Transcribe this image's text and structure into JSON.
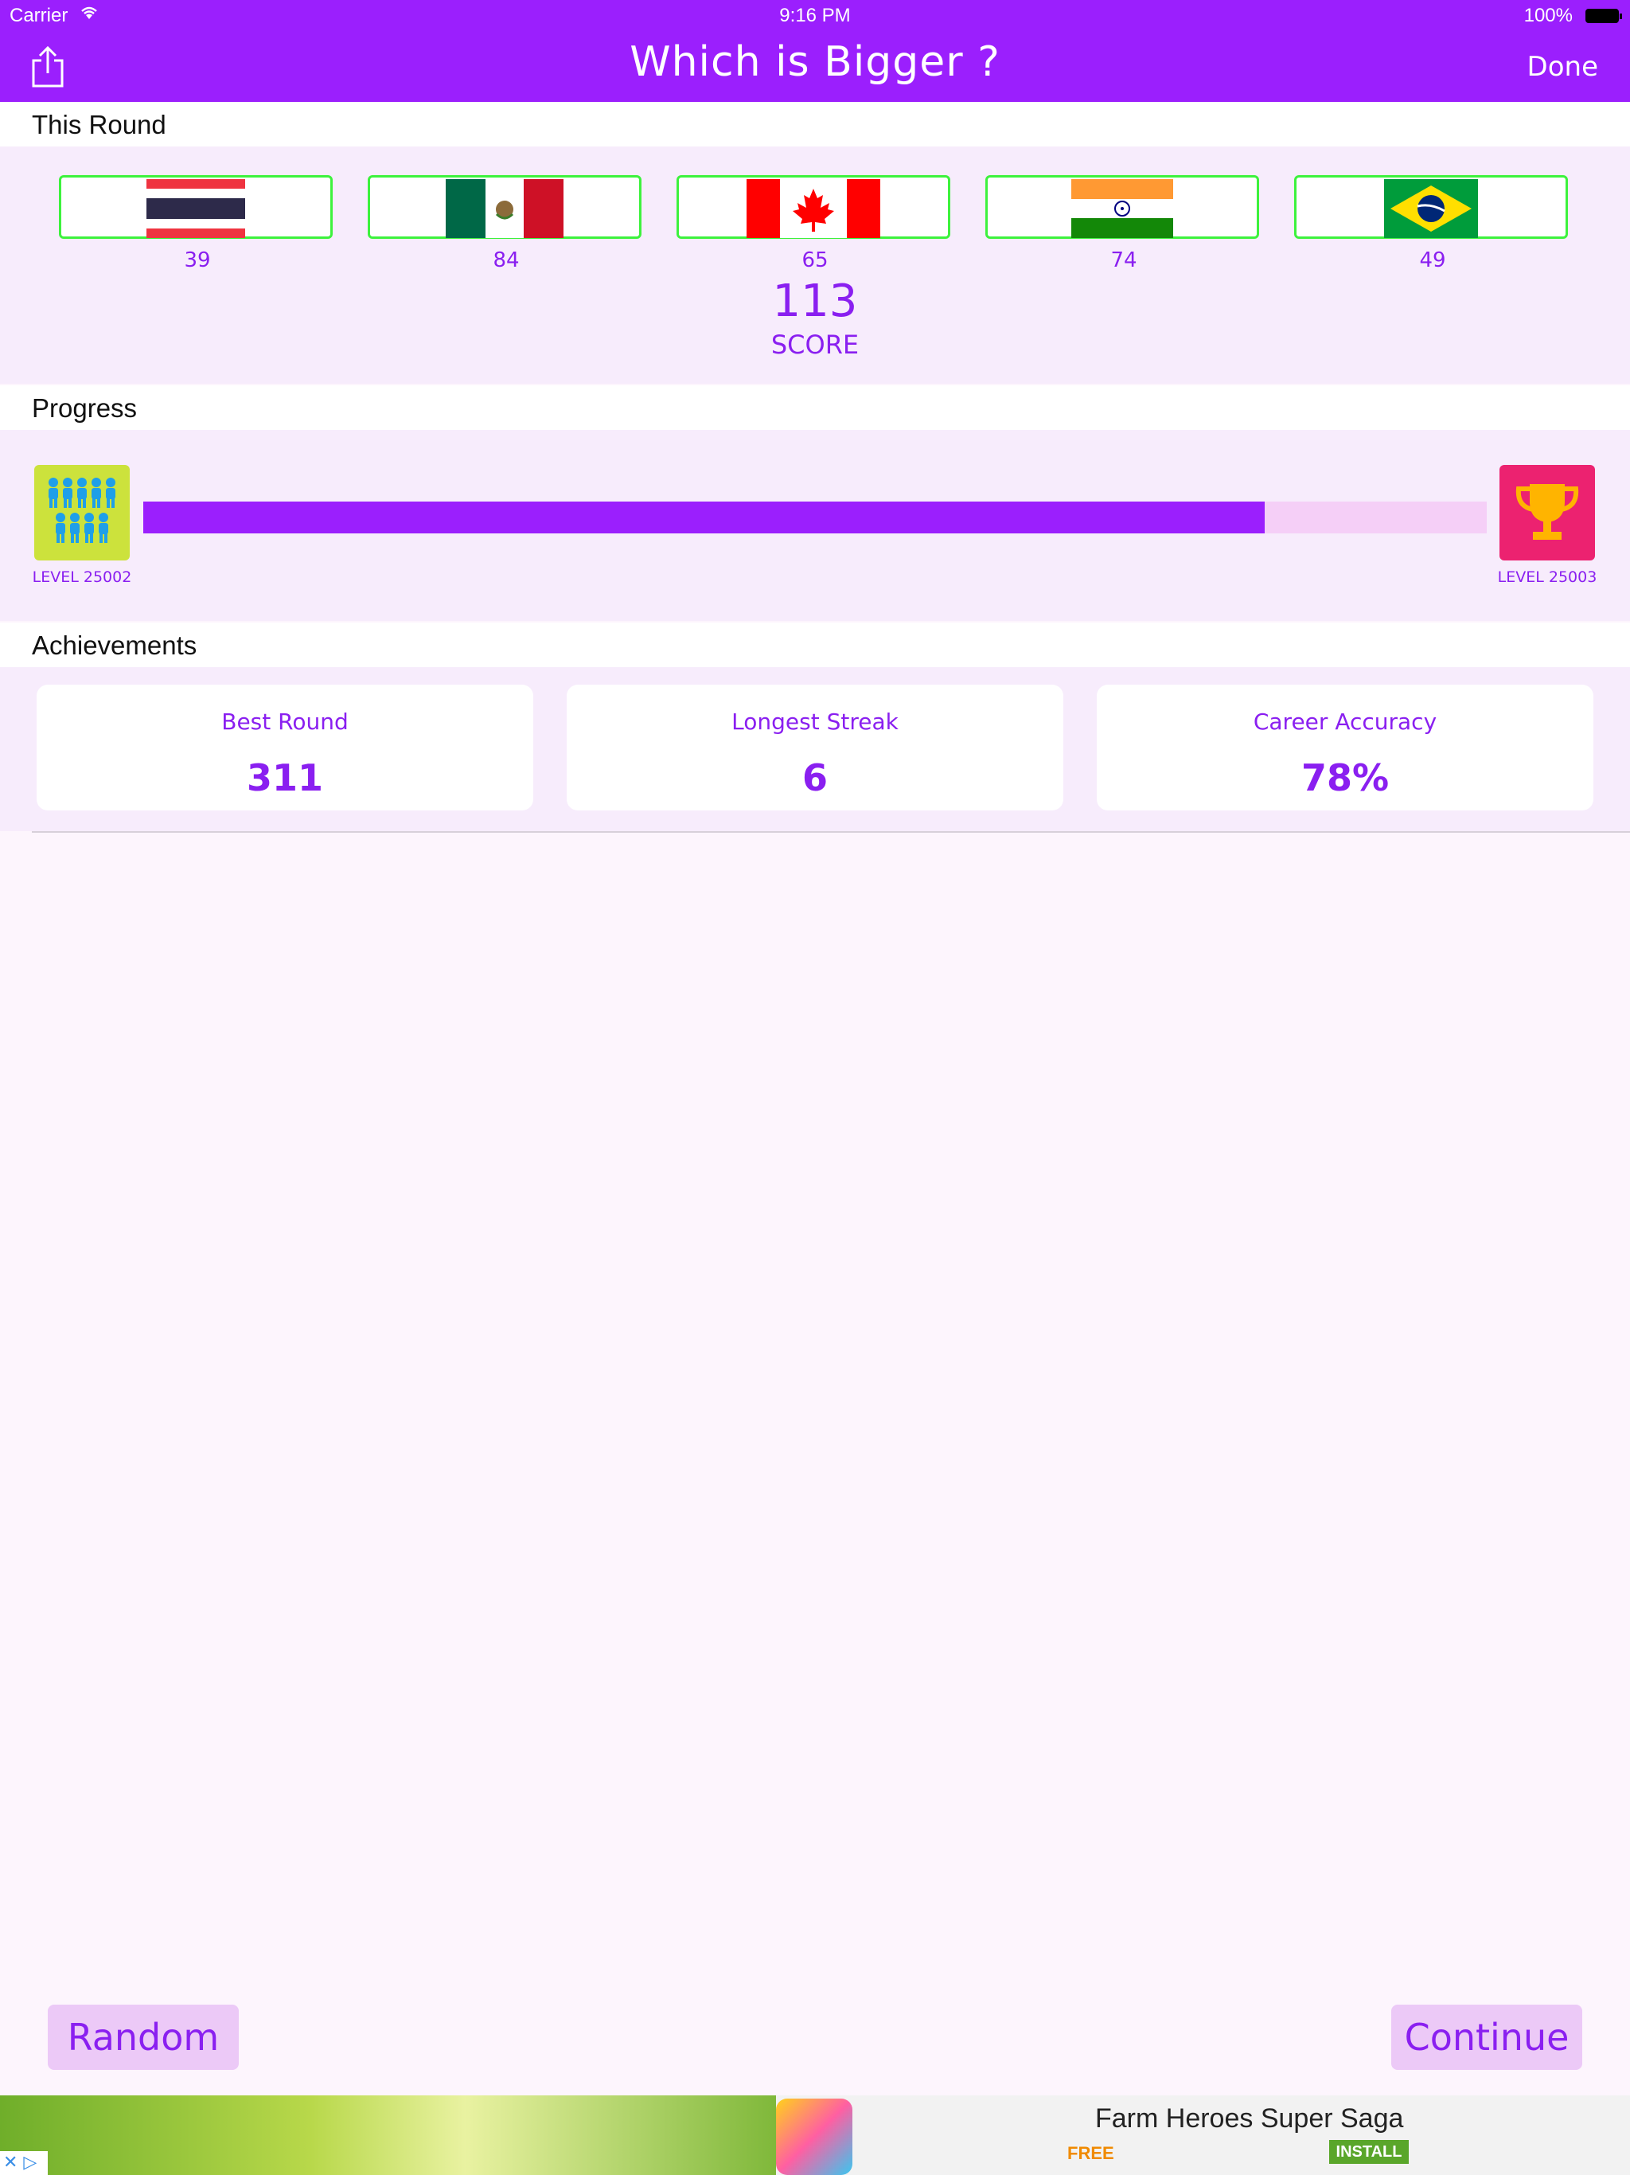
{
  "status_bar": {
    "carrier": "Carrier",
    "time": "9:16 PM",
    "battery": "100%"
  },
  "nav": {
    "title": "Which is Bigger ?",
    "done_label": "Done"
  },
  "sections": {
    "this_round": "This Round",
    "progress": "Progress",
    "achievements": "Achievements"
  },
  "round": {
    "flags": [
      {
        "country": "Thailand",
        "value": "39"
      },
      {
        "country": "Mexico",
        "value": "84"
      },
      {
        "country": "Canada",
        "value": "65"
      },
      {
        "country": "India",
        "value": "74"
      },
      {
        "country": "Brazil",
        "value": "49"
      }
    ],
    "score": "113",
    "score_label": "SCORE"
  },
  "progress": {
    "current_level": "LEVEL 25002",
    "next_level": "LEVEL 25003",
    "fraction": 0.835,
    "current_icon": "people-group-icon",
    "next_icon": "trophy-icon"
  },
  "achievements": {
    "best_round": {
      "label": "Best Round",
      "value": "311"
    },
    "longest_streak": {
      "label": "Longest Streak",
      "value": "6"
    },
    "career_accuracy": {
      "label": "Career Accuracy",
      "value": "78%"
    }
  },
  "buttons": {
    "random": "Random",
    "continue": "Continue"
  },
  "ad": {
    "title": "Farm Heroes Super Saga",
    "price": "FREE",
    "install": "INSTALL"
  },
  "colors": {
    "accent": "#9b1ffd",
    "text_purple": "#8a1ff0",
    "flag_border": "#3df23d",
    "progress_track": "#f5cff7"
  }
}
